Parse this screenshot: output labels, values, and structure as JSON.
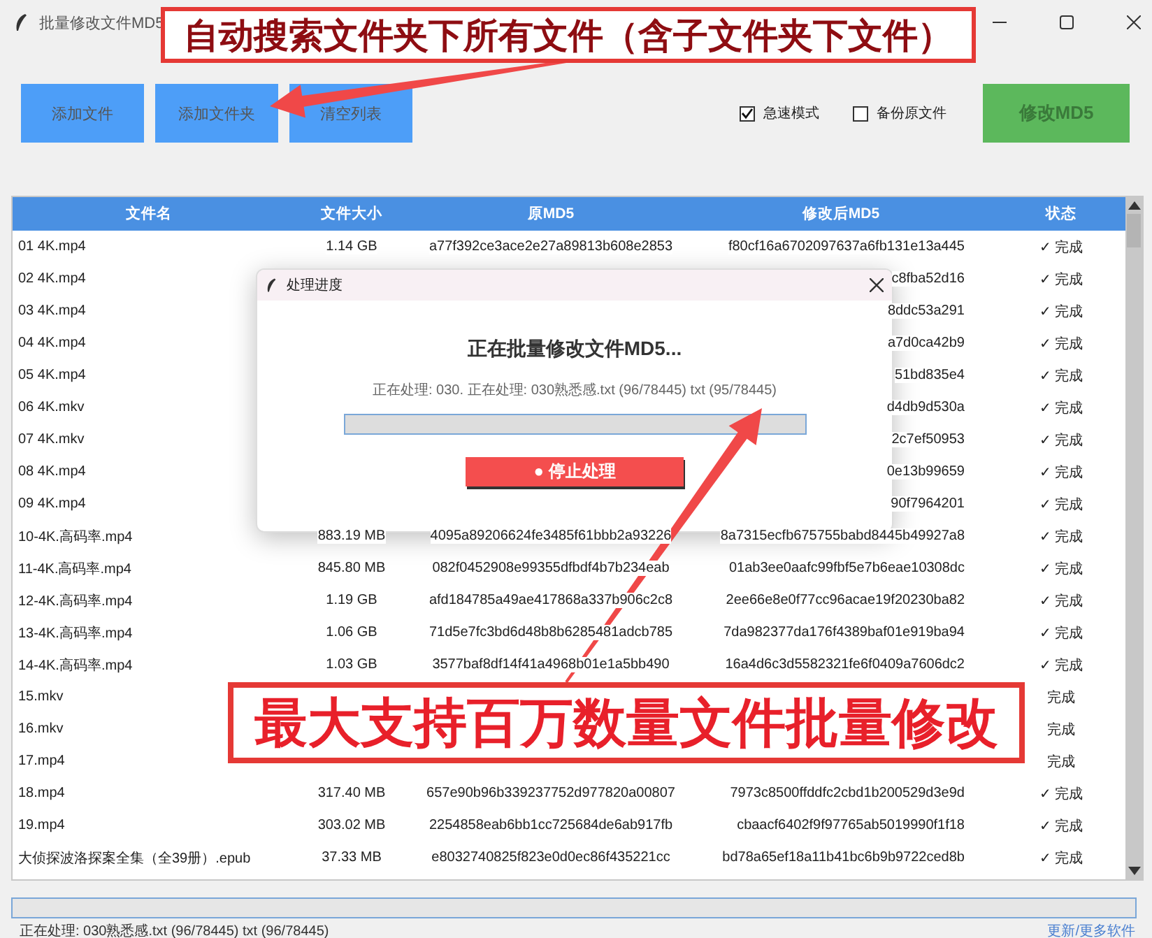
{
  "window": {
    "title": "批量修改文件MD5"
  },
  "toolbar": {
    "buttons": [
      {
        "label": "添加文件",
        "kind": "blue"
      },
      {
        "label": "添加文件夹",
        "kind": "blue"
      },
      {
        "label": "清空列表",
        "kind": "blue"
      }
    ],
    "options": [
      {
        "label": "急速模式",
        "checked": true
      },
      {
        "label": "备份原文件",
        "checked": false
      }
    ],
    "action": {
      "label": "修改MD5"
    }
  },
  "table": {
    "columns": [
      "文件名",
      "文件大小",
      "原MD5",
      "修改后MD5",
      "状态"
    ],
    "rows": [
      {
        "name": "01 4K.mp4",
        "size": "1.14 GB",
        "original_md5": "a77f392ce3ace2e27a89813b608e2853",
        "modified_md5": "f80cf16a6702097637a6fb131e13a445",
        "status": "✓ 完成"
      },
      {
        "name": "02 4K.mp4",
        "modified_md5": "c8fba52d16",
        "status": "✓ 完成"
      },
      {
        "name": "03 4K.mp4",
        "modified_md5": "8ddc53a291",
        "status": "✓ 完成"
      },
      {
        "name": "04 4K.mp4",
        "modified_md5": "a7d0ca42b9",
        "status": "✓ 完成"
      },
      {
        "name": "05 4K.mp4",
        "modified_md5": "51bd835e4",
        "status": "✓ 完成"
      },
      {
        "name": "06 4K.mkv",
        "modified_md5": "d4db9d530a",
        "status": "✓ 完成"
      },
      {
        "name": "07 4K.mkv",
        "modified_md5": "2c7ef50953",
        "status": "✓ 完成"
      },
      {
        "name": "08 4K.mp4",
        "modified_md5": "0e13b99659",
        "status": "✓ 完成"
      },
      {
        "name": "09 4K.mp4",
        "modified_md5": "90f7964201",
        "status": "✓ 完成"
      },
      {
        "name": "10-4K.高码率.mp4",
        "size": "883.19 MB",
        "original_md5": "4095a89206624fe3485f61bbb2a93226",
        "modified_md5": "8a7315ecfb675755babd8445b49927a8",
        "status": "✓ 完成"
      },
      {
        "name": "11-4K.高码率.mp4",
        "size": "845.80 MB",
        "original_md5": "082f0452908e99355dfbdf4b7b234eab",
        "modified_md5": "01ab3ee0aafc99fbf5e7b6eae10308dc",
        "status": "✓ 完成"
      },
      {
        "name": "12-4K.高码率.mp4",
        "size": "1.19 GB",
        "original_md5": "afd184785a49ae417868a337b906c2c8",
        "modified_md5": "2ee66e8e0f77cc96acae19f20230ba82",
        "status": "✓ 完成"
      },
      {
        "name": "13-4K.高码率.mp4",
        "size": "1.06 GB",
        "original_md5": "71d5e7fc3bd6d48b8b6285481adcb785",
        "modified_md5": "7da982377da176f4389baf01e919ba94",
        "status": "✓ 完成"
      },
      {
        "name": "14-4K.高码率.mp4",
        "size": "1.03 GB",
        "original_md5": "3577baf8df14f41a4968b01e1a5bb490",
        "modified_md5": "16a4d6c3d5582321fe6f0409a7606dc2",
        "status": "✓ 完成"
      },
      {
        "name": "15.mkv",
        "status": "完成"
      },
      {
        "name": "16.mkv",
        "status": "完成"
      },
      {
        "name": "17.mp4",
        "status": "完成"
      },
      {
        "name": "18.mp4",
        "size": "317.40 MB",
        "original_md5": "657e90b96b339237752d977820a00807",
        "modified_md5": "7973c8500ffddfc2cbd1b200529d3e9d",
        "status": "✓ 完成"
      },
      {
        "name": "19.mp4",
        "size": "303.02 MB",
        "original_md5": "2254858eab6bb1cc725684de6ab917fb",
        "modified_md5": "cbaacf6402f9f97765ab5019990f1f18",
        "status": "✓ 完成"
      },
      {
        "name": "大侦探波洛探案全集（全39册）.epub",
        "size": "37.33 MB",
        "original_md5": "e8032740825f823e0d0ec86f435221cc",
        "modified_md5": "bd78a65ef18a11b41bc6b9b9722ced8b",
        "status": "✓ 完成"
      }
    ]
  },
  "progress": {
    "level": 0
  },
  "status_bar": {
    "text": "正在处理: 030熟悉感.txt (96/78445) txt (96/78445)",
    "link": "更新/更多软件"
  },
  "dialog": {
    "title": "处理进度",
    "heading": "正在批量修改文件MD5...",
    "detail": "正在处理: 030. 正在处理: 030熟悉感.txt (96/78445) txt (95/78445)",
    "progress": {
      "level": 0
    },
    "button": "● 停止处理"
  },
  "annotations": [
    {
      "text": "自动搜索文件夹下所有文件（含子文件夹下文件）"
    },
    {
      "text": "最大支持百万数量文件批量修改"
    }
  ]
}
